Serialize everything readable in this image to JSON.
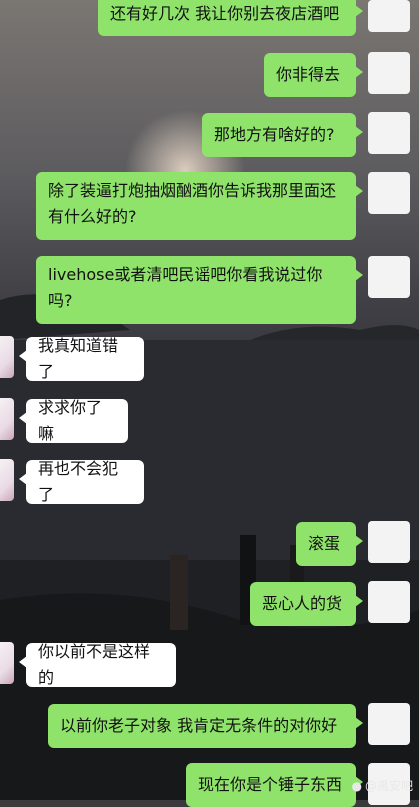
{
  "messages": [
    {
      "side": "right",
      "text": "还有好几次 我让你别去夜店酒吧"
    },
    {
      "side": "right",
      "text": "你非得去"
    },
    {
      "side": "right",
      "text": "那地方有啥好的?"
    },
    {
      "side": "right",
      "text": "除了装逼打炮抽烟酗酒你告诉我那里面还有什么好的?"
    },
    {
      "side": "right",
      "text": "livehose或者清吧民谣吧你看我说过你吗?"
    },
    {
      "side": "left",
      "text": "我真知道错了"
    },
    {
      "side": "left",
      "text": "求求你了嘛"
    },
    {
      "side": "left",
      "text": "再也不会犯了"
    },
    {
      "side": "right",
      "text": "滚蛋"
    },
    {
      "side": "right",
      "text": "恶心人的货"
    },
    {
      "side": "left",
      "text": "你以前不是这样的"
    },
    {
      "side": "right",
      "text": "以前你老子对象 我肯定无条件的对你好"
    },
    {
      "side": "right",
      "text": "现在你是个锤子东西"
    }
  ],
  "watermark": {
    "text": "@禹安吧",
    "icon": "weibo-icon"
  },
  "colors": {
    "sent_bubble": "#8fe36b",
    "received_bubble": "#ffffff"
  }
}
